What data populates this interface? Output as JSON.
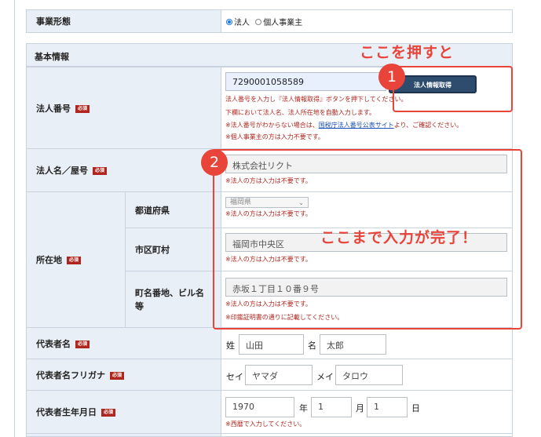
{
  "business_type": {
    "label": "事業形態",
    "options": [
      "法人",
      "個人事業主"
    ],
    "selected": "法人"
  },
  "section_title": "基本情報",
  "required_badge": "必須",
  "corporate_number": {
    "label": "法人番号",
    "value": "7290001058589",
    "button": "法人情報取得",
    "note1": "法人番号を入力し『法人情報取得』ボタンを押下してください。",
    "note2": "下欄において法人名、法人所在地を自動入力します。",
    "note3_pre": "※法人番号がわからない場合は、",
    "note3_link": "国税庁法人番号公表サイト",
    "note3_post": "より、ご確認ください。",
    "note4": "※個人事業主の方は入力不要です。"
  },
  "corporate_name": {
    "label": "法人名／屋号",
    "value": "株式会社リクト",
    "note": "※法人の方は入力は不要です。"
  },
  "address": {
    "label": "所在地",
    "prefecture_label": "都道府県",
    "prefecture_value": "福岡県",
    "prefecture_note": "※法人の方は入力は不要です。",
    "city_label": "市区町村",
    "city_value": "福岡市中央区",
    "city_note": "※法人の方は入力は不要です。",
    "street_label_1": "町名番地、ビル名",
    "street_label_2": "等",
    "street_value": "赤坂１丁目１０番９号",
    "street_note1": "※法人の方は入力は不要です。",
    "street_note2": "※印鑑証明書の通りに記載してください。"
  },
  "representative": {
    "label": "代表者名",
    "last_label": "姓",
    "last_value": "山田",
    "first_label": "名",
    "first_value": "太郎"
  },
  "representative_kana": {
    "label": "代表者名フリガナ",
    "last_label": "セイ",
    "last_value": "ヤマダ",
    "first_label": "メイ",
    "first_value": "タロウ"
  },
  "birthdate": {
    "label": "代表者生年月日",
    "year_value": "1970",
    "year_unit": "年",
    "month_value": "1",
    "month_unit": "月",
    "day_value": "1",
    "day_unit": "日",
    "note": "※西暦で入力してください。"
  },
  "annotations": {
    "badge1": "1",
    "badge2": "2",
    "text1": "ここを押すと",
    "text2": "ここまで入力が完了！"
  },
  "colors": {
    "annotation": "#e8443a",
    "required": "#b0261e",
    "button": "#2d4c6e",
    "header_bg": "#e9eff6"
  }
}
